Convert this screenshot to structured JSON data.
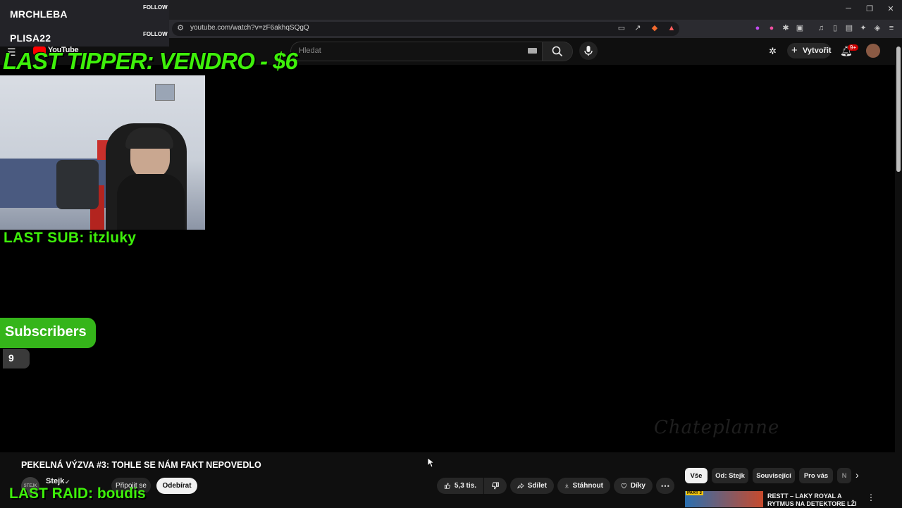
{
  "overlay": {
    "followers": [
      {
        "name": "MRCHLEBA",
        "action": "FOLLOW"
      },
      {
        "name": "PLISA22",
        "action": "FOLLOW"
      }
    ],
    "last_tipper": "LAST TIPPER: VENDRO - $6",
    "last_sub": "LAST SUB: itzluky",
    "subscribers_label": "Subscribers",
    "subscribers_count": "9",
    "last_raid": "LAST RAID: boudis",
    "accent_color": "#3ef00a"
  },
  "browser": {
    "url": "youtube.com/watch?v=zF6akhqSQgQ"
  },
  "youtube": {
    "logo": "YouTube",
    "search_placeholder": "Hledat",
    "create_label": "Vytvořit",
    "notifications_badge": "9+",
    "player_watermark": "Chateplanne"
  },
  "video": {
    "title": "PEKELNÁ VÝZVA #3: TOHLE SE NÁM FAKT NEPOVEDLO",
    "channel": "Stejk",
    "channel_avatar_text": "STEJK",
    "join_label": "Připojit se",
    "subscribe_label": "Odebírat",
    "actions": {
      "like_count": "5,3 tis.",
      "share": "Sdílet",
      "download": "Stáhnout",
      "thanks": "Díky"
    }
  },
  "sidebar": {
    "chips": [
      "Vše",
      "Od: Stejk",
      "Související",
      "Pro vás",
      "N"
    ],
    "recommendation": {
      "badge": "PART 3",
      "title": "RESTT – LAKY ROYAL A RYTMUS NA DETEKTORE LŽI"
    }
  }
}
